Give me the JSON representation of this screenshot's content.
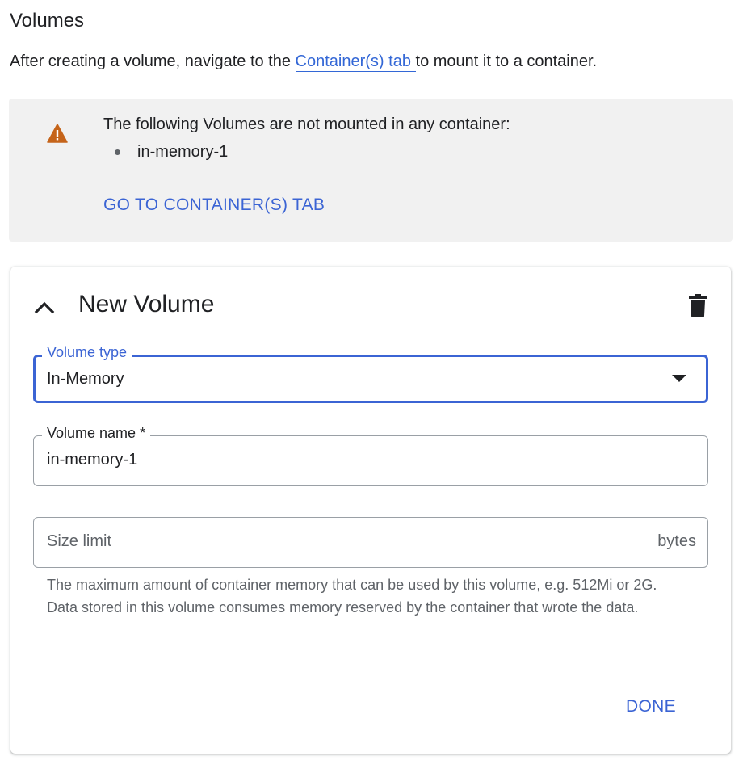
{
  "volumes": {
    "title": "Volumes",
    "intro_before": "After creating a volume, navigate to the ",
    "intro_link": "Container(s) tab ",
    "intro_after": "to mount it to a container."
  },
  "warning": {
    "icon": "warning-icon",
    "icon_color": "#c5641a",
    "message": "The following Volumes are not mounted in any container:",
    "items": [
      "in-memory-1"
    ],
    "action_label": "GO TO CONTAINER(S) TAB"
  },
  "card": {
    "title": "New Volume",
    "collapse_icon": "chevron-up-icon",
    "delete_icon": "trash-icon",
    "volume_type": {
      "label": "Volume type",
      "value": "In-Memory"
    },
    "volume_name": {
      "label": "Volume name *",
      "value": "in-memory-1"
    },
    "size_limit": {
      "placeholder": "Size limit",
      "suffix": "bytes",
      "hint": "The maximum amount of container memory that can be used by this volume, e.g. 512Mi or 2G. Data stored in this volume consumes memory reserved by the container that wrote the data."
    },
    "done_label": "DONE"
  },
  "colors": {
    "accent": "#3b64d4",
    "warning_bg": "#f1f1f1",
    "text": "#202124",
    "secondary_text": "#5f6368"
  }
}
